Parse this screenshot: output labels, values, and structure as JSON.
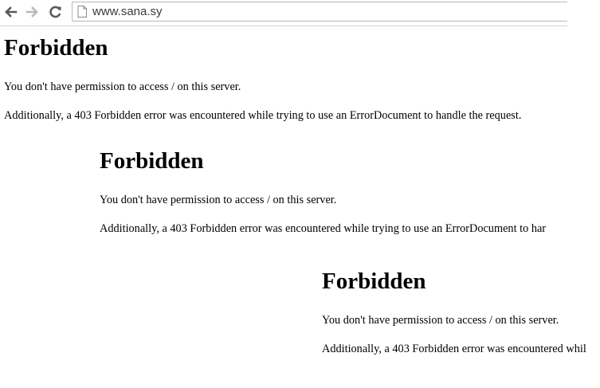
{
  "browser": {
    "url": "www.sana.sy",
    "icons": {
      "back": "back-arrow-icon",
      "forward": "forward-arrow-icon",
      "reload": "reload-icon",
      "page": "page-icon"
    }
  },
  "pages": [
    {
      "title": "Forbidden",
      "line1": "You don't have permission to access / on this server.",
      "line2": "Additionally, a 403 Forbidden error was encountered while trying to use an ErrorDocument to handle the request."
    },
    {
      "title": "Forbidden",
      "line1": "You don't have permission to access / on this server.",
      "line2": "Additionally, a 403 Forbidden error was encountered while trying to use an ErrorDocument to har"
    },
    {
      "title": "Forbidden",
      "line1": "You don't have permission to access / on this server.",
      "line2": "Additionally, a 403 Forbidden error was encountered whil"
    }
  ]
}
